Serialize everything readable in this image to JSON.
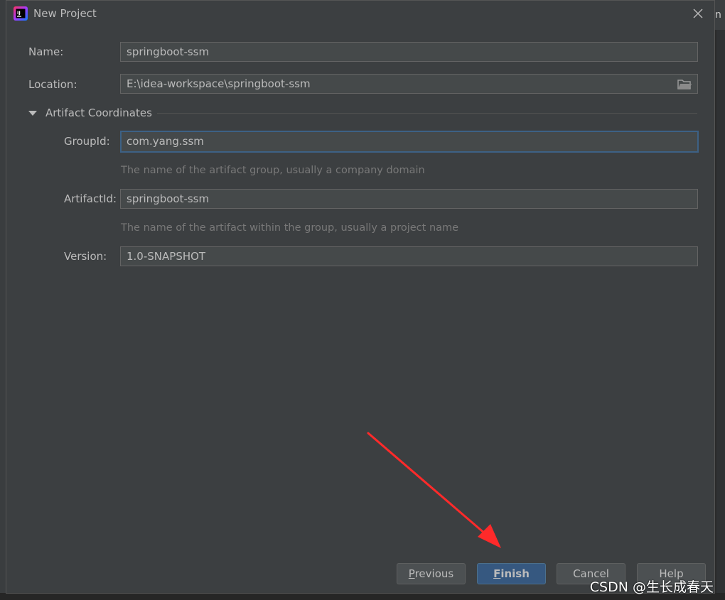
{
  "window": {
    "title": "New Project",
    "background_edge_text": "n"
  },
  "form": {
    "name": {
      "label": "Name:",
      "value": "springboot-ssm"
    },
    "location": {
      "label": "Location:",
      "value": "E:\\idea-workspace\\springboot-ssm"
    },
    "section": {
      "label": "Artifact Coordinates",
      "expanded": true
    },
    "group_id": {
      "label": "GroupId:",
      "value": "com.yang.ssm",
      "hint": "The name of the artifact group, usually a company domain"
    },
    "artifact_id": {
      "label": "ArtifactId:",
      "value": "springboot-ssm",
      "hint": "The name of the artifact within the group, usually a project name"
    },
    "version": {
      "label": "Version:",
      "value": "1.0-SNAPSHOT"
    }
  },
  "buttons": {
    "previous": {
      "mnemonic": "P",
      "rest": "revious"
    },
    "finish": {
      "mnemonic": "F",
      "rest": "inish"
    },
    "cancel": "Cancel",
    "help": "Help"
  },
  "watermark": "CSDN @生长成春天",
  "colors": {
    "dialog_bg": "#3c3f41",
    "field_bg": "#45494a",
    "focus_border": "#3d6185",
    "primary_button": "#365880",
    "annotation_arrow": "#ff2a2a"
  },
  "icons": {
    "app": "intellij-idea-icon",
    "close": "close-icon",
    "folder": "folder-icon",
    "section_toggle": "triangle-down-icon"
  }
}
